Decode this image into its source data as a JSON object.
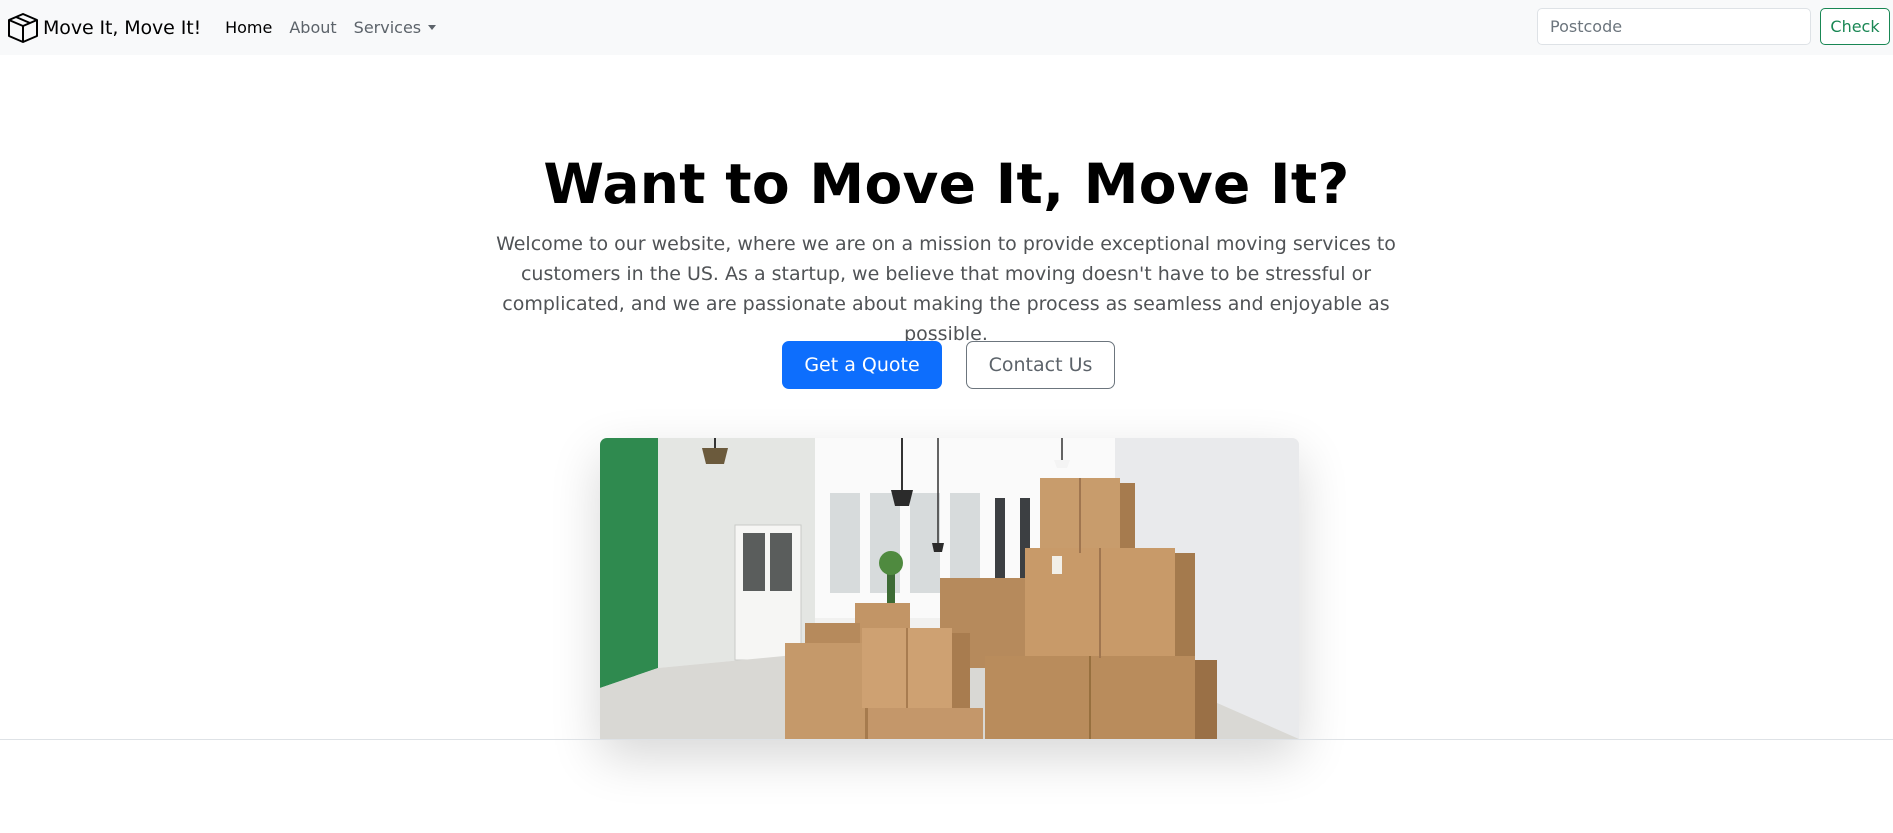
{
  "navbar": {
    "brand": "Move It, Move It!",
    "brand_icon": "box-icon",
    "links": [
      {
        "label": "Home",
        "active": true
      },
      {
        "label": "About",
        "active": false
      },
      {
        "label": "Services",
        "active": false,
        "dropdown": true
      }
    ],
    "search": {
      "placeholder": "Postcode",
      "value": ""
    },
    "check_label": "Check"
  },
  "hero": {
    "title": "Want to Move It, Move It?",
    "lead": "Welcome to our website, where we are on a mission to provide exceptional moving services to customers in the US. As a startup, we believe that moving doesn't have to be stressful or complicated, and we are passionate about making the process as seamless and enjoyable as possible.",
    "primary_button": "Get a Quote",
    "secondary_button": "Contact Us"
  },
  "colors": {
    "primary": "#0d6efd",
    "success": "#198754",
    "navbar_bg": "#f8f9fa",
    "secondary_text": "#6c757d"
  }
}
